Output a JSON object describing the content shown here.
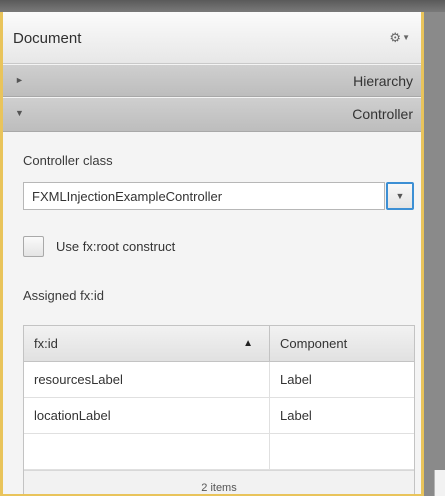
{
  "document": {
    "title": "Document",
    "settings_icon": "gear-icon"
  },
  "sections": {
    "hierarchy": {
      "label": "Hierarchy",
      "arrow": "►",
      "expanded": false
    },
    "controller": {
      "label": "Controller",
      "arrow": "▼",
      "expanded": true
    }
  },
  "controller": {
    "class_label": "Controller class",
    "class_value": "FXMLInjectionExampleController",
    "dropdown_arrow": "▼",
    "use_fxroot_label": "Use fx:root construct",
    "use_fxroot_checked": false,
    "assigned_label": "Assigned fx:id"
  },
  "table": {
    "columns": [
      "fx:id",
      "Component"
    ],
    "sort_indicator": "▲",
    "rows": [
      [
        "resourcesLabel",
        "Label"
      ],
      [
        "locationLabel",
        "Label"
      ],
      [
        "",
        ""
      ]
    ],
    "footer": "2 items"
  },
  "colors": {
    "accent_border": "#e9c45b",
    "focus_blue": "#3c8fd4"
  }
}
